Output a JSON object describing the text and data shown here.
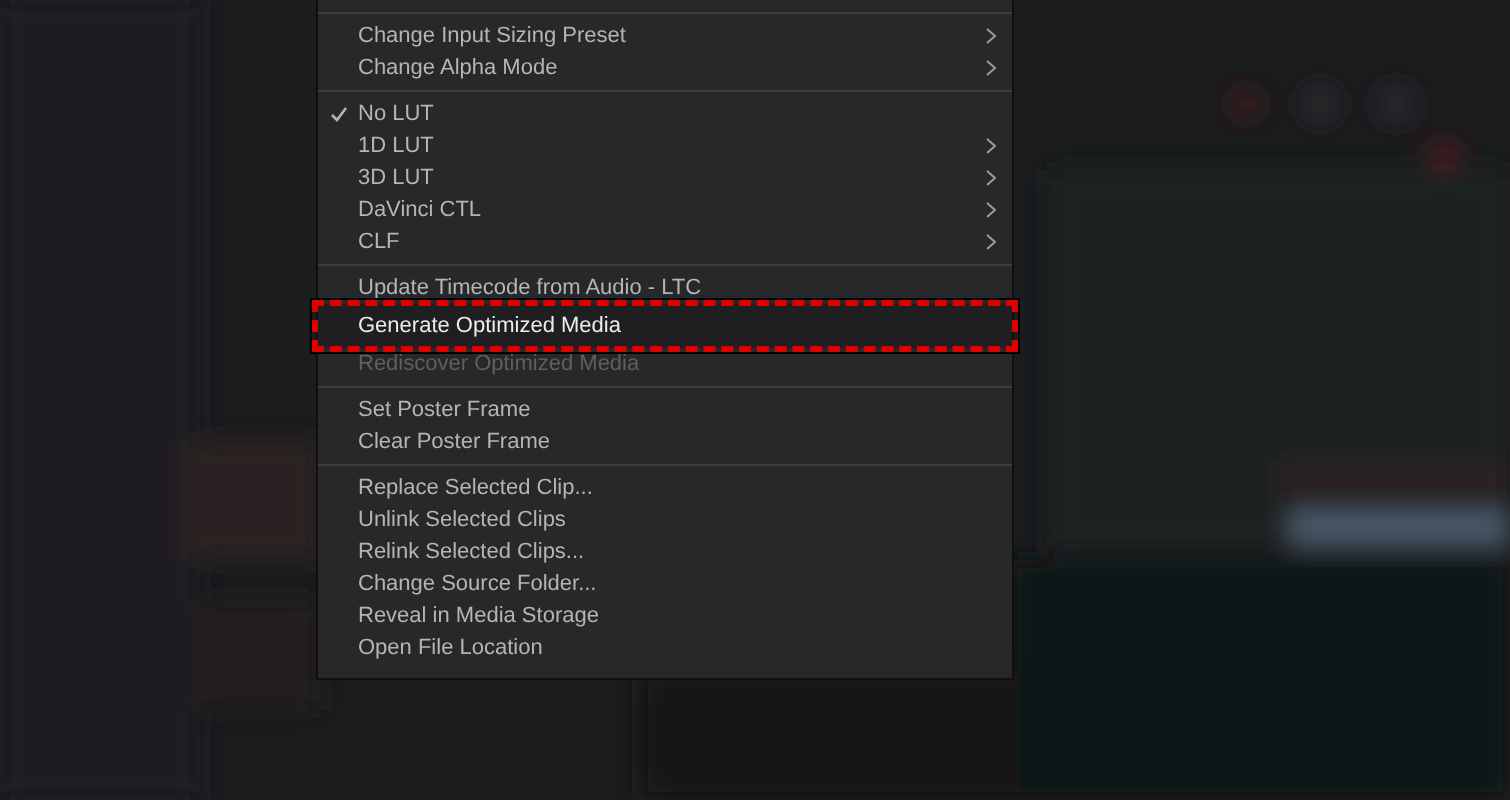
{
  "context_menu": {
    "sections": [
      {
        "items": [
          {
            "label": "Change Input Sizing Preset",
            "submenu": true,
            "checked": false,
            "disabled": false,
            "selected": false,
            "annotated": false
          },
          {
            "label": "Change Alpha Mode",
            "submenu": true,
            "checked": false,
            "disabled": false,
            "selected": false,
            "annotated": false
          }
        ]
      },
      {
        "items": [
          {
            "label": "No LUT",
            "submenu": false,
            "checked": true,
            "disabled": false,
            "selected": false,
            "annotated": false
          },
          {
            "label": "1D LUT",
            "submenu": true,
            "checked": false,
            "disabled": false,
            "selected": false,
            "annotated": false
          },
          {
            "label": "3D LUT",
            "submenu": true,
            "checked": false,
            "disabled": false,
            "selected": false,
            "annotated": false
          },
          {
            "label": "DaVinci CTL",
            "submenu": true,
            "checked": false,
            "disabled": false,
            "selected": false,
            "annotated": false
          },
          {
            "label": "CLF",
            "submenu": true,
            "checked": false,
            "disabled": false,
            "selected": false,
            "annotated": false
          }
        ]
      },
      {
        "items": [
          {
            "label": "Update Timecode from Audio - LTC",
            "submenu": false,
            "checked": false,
            "disabled": false,
            "selected": false,
            "annotated": false
          },
          {
            "label": "Generate Optimized Media",
            "submenu": false,
            "checked": false,
            "disabled": false,
            "selected": true,
            "annotated": true
          },
          {
            "label": "Rediscover Optimized Media",
            "submenu": false,
            "checked": false,
            "disabled": true,
            "selected": false,
            "annotated": false
          }
        ]
      },
      {
        "items": [
          {
            "label": "Set Poster Frame",
            "submenu": false,
            "checked": false,
            "disabled": false,
            "selected": false,
            "annotated": false
          },
          {
            "label": "Clear Poster Frame",
            "submenu": false,
            "checked": false,
            "disabled": false,
            "selected": false,
            "annotated": false
          }
        ]
      },
      {
        "items": [
          {
            "label": "Replace Selected Clip...",
            "submenu": false,
            "checked": false,
            "disabled": false,
            "selected": false,
            "annotated": false
          },
          {
            "label": "Unlink Selected Clips",
            "submenu": false,
            "checked": false,
            "disabled": false,
            "selected": false,
            "annotated": false
          },
          {
            "label": "Relink Selected Clips...",
            "submenu": false,
            "checked": false,
            "disabled": false,
            "selected": false,
            "annotated": false
          },
          {
            "label": "Change Source Folder...",
            "submenu": false,
            "checked": false,
            "disabled": false,
            "selected": false,
            "annotated": false
          },
          {
            "label": "Reveal in Media Storage",
            "submenu": false,
            "checked": false,
            "disabled": false,
            "selected": false,
            "annotated": false
          },
          {
            "label": "Open File Location",
            "submenu": false,
            "checked": false,
            "disabled": false,
            "selected": false,
            "annotated": false
          }
        ]
      }
    ]
  }
}
